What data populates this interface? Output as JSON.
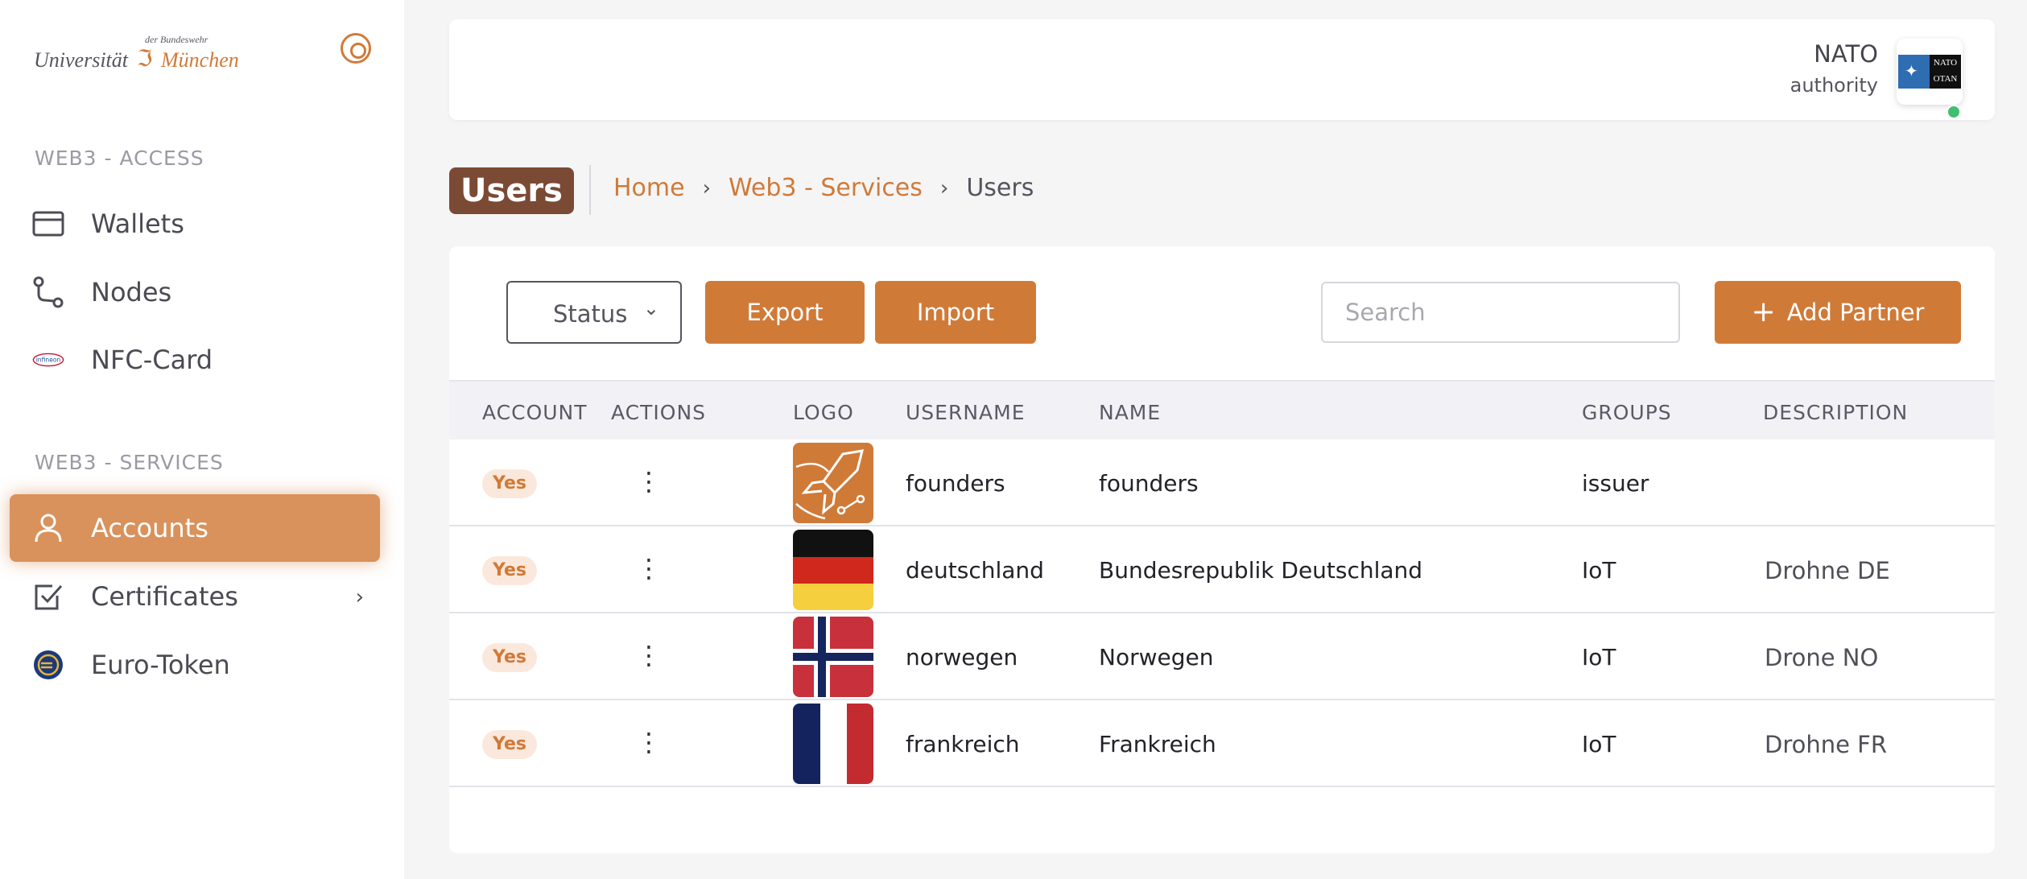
{
  "brand": {
    "university": "Universität",
    "subtitle": "der Bundeswehr",
    "city": "München"
  },
  "sidebar": {
    "sections": [
      {
        "title": "WEB3 - ACCESS"
      },
      {
        "title": "WEB3 - SERVICES"
      }
    ],
    "items": [
      {
        "label": "Wallets",
        "icon": "wallet-icon"
      },
      {
        "label": "Nodes",
        "icon": "route-icon"
      },
      {
        "label": "NFC-Card",
        "icon": "infineon-logo",
        "logo_text": "infineon"
      },
      {
        "label": "Accounts",
        "icon": "user-icon",
        "active": true
      },
      {
        "label": "Certificates",
        "icon": "checkbox-icon"
      },
      {
        "label": "Euro-Token",
        "icon": "euro-coin-icon"
      }
    ]
  },
  "header": {
    "user_name": "NATO",
    "user_role": "authority",
    "avatar_text": [
      "NATO",
      "OTAN"
    ],
    "status_color": "#3fbf6f"
  },
  "page": {
    "title": "Users",
    "breadcrumb": [
      "Home",
      "Web3 - Services",
      "Users"
    ]
  },
  "toolbar": {
    "status_label": "Status",
    "export_label": "Export",
    "import_label": "Import",
    "search_placeholder": "Search",
    "add_label": "Add Partner"
  },
  "table": {
    "columns": [
      "ACCOUNT",
      "ACTIONS",
      "LOGO",
      "USERNAME",
      "NAME",
      "GROUPS",
      "DESCRIPTION"
    ],
    "rows": [
      {
        "account": "Yes",
        "logo": "founders-logo",
        "username": "founders",
        "name": "founders",
        "groups": "issuer",
        "description": ""
      },
      {
        "account": "Yes",
        "logo": "germany-flag",
        "username": "deutschland",
        "name": "Bundesrepublik Deutschland",
        "groups": "IoT",
        "description": "Drohne DE"
      },
      {
        "account": "Yes",
        "logo": "norway-flag",
        "username": "norwegen",
        "name": "Norwegen",
        "groups": "IoT",
        "description": "Drone NO"
      },
      {
        "account": "Yes",
        "logo": "france-flag",
        "username": "frankreich",
        "name": "Frankreich",
        "groups": "IoT",
        "description": "Drohne FR"
      }
    ]
  },
  "colors": {
    "accent": "#d07a38",
    "title_bg": "#7b4a35",
    "active_nav": "#d9925c"
  }
}
